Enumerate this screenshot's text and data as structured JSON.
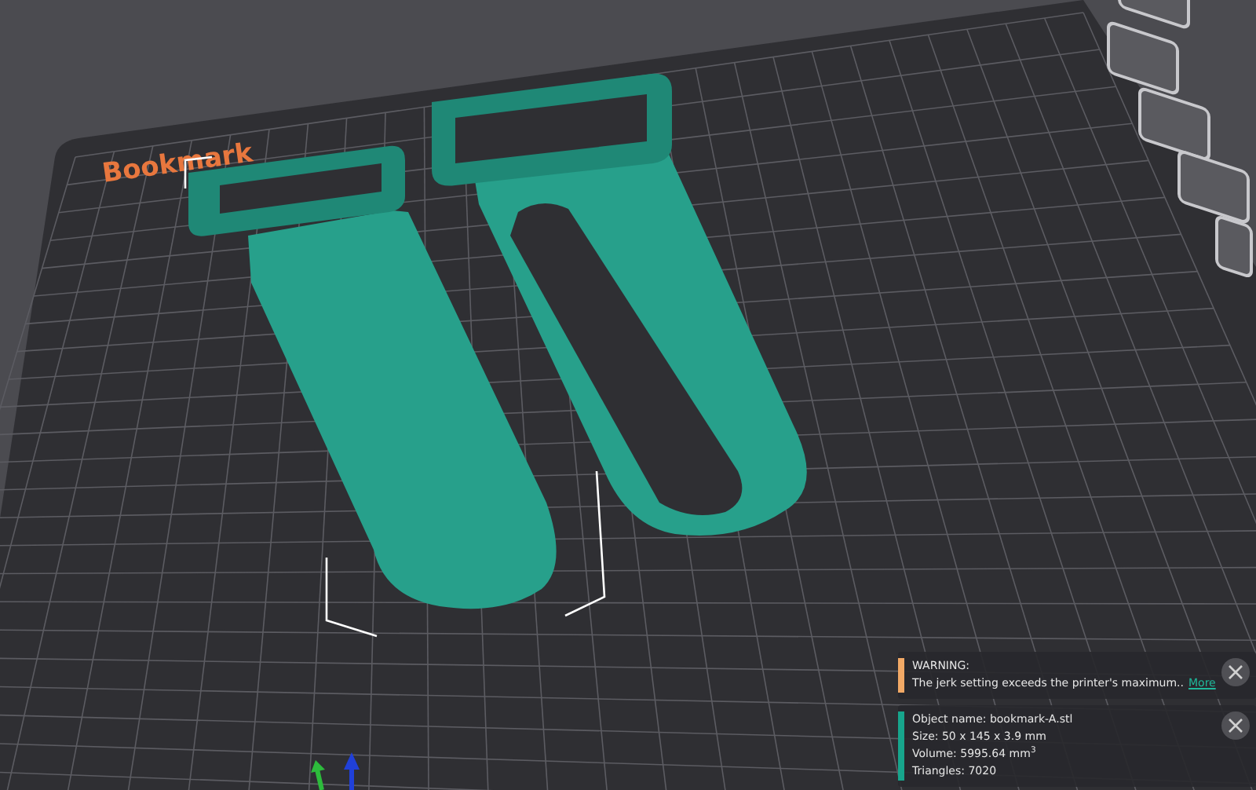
{
  "scene": {
    "plate_label": "Bookmark"
  },
  "notifications": [
    {
      "color": "#f2a966",
      "lines": [
        "WARNING:",
        "The jerk setting exceeds the printer's maximum.."
      ],
      "link": "More"
    },
    {
      "color": "#17a58c",
      "lines": [
        "Object name: bookmark-A.stl",
        "Size: 50 x 145 x 3.9 mm",
        "Volume: 5995.64 mm$^{3}$",
        "Triangles: 7020"
      ]
    }
  ]
}
